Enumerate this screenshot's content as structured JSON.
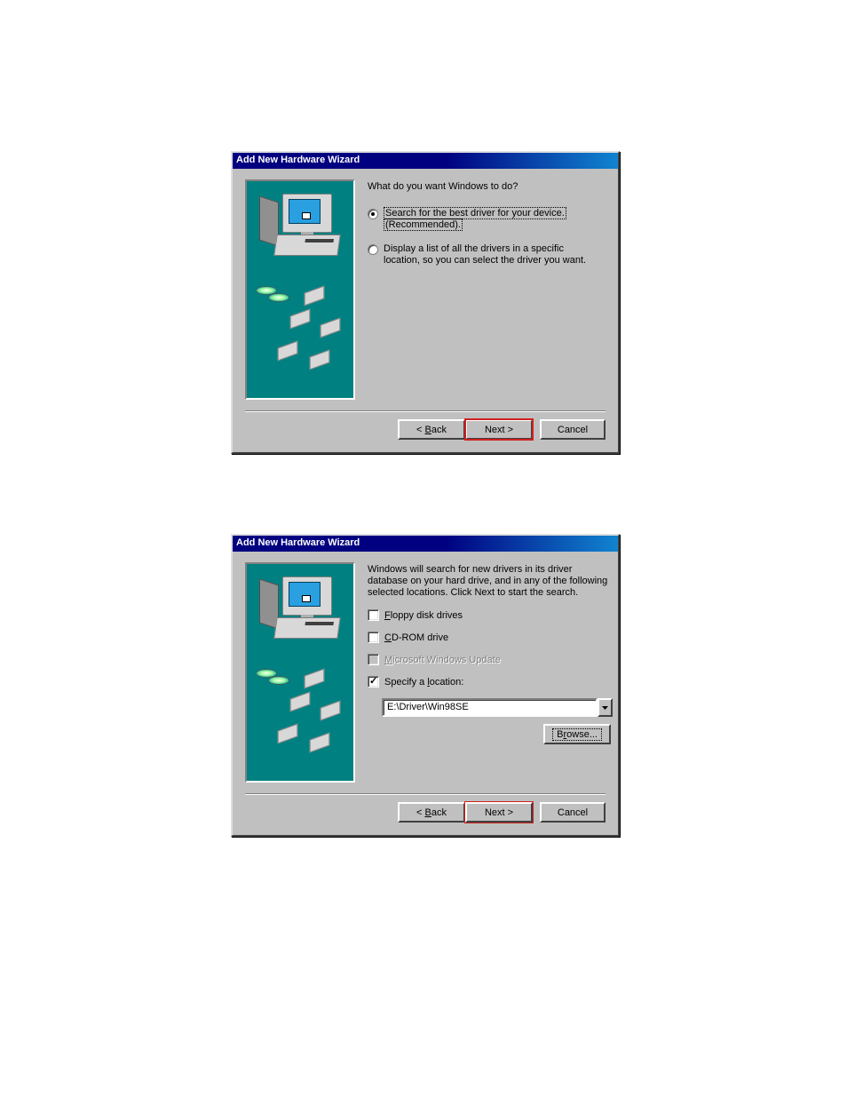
{
  "dialog1": {
    "title": "Add New Hardware Wizard",
    "prompt": "What do you want Windows to do?",
    "option1_line1": "Search for the best driver for your device.",
    "option1_line2": "(Recommended).",
    "option2_line1": "Display a list of all the drivers in a specific",
    "option2_line2": "location, so you can select the driver you want.",
    "back_label": "< ",
    "back_label2": "ack",
    "back_u": "B",
    "next_label": "Next >",
    "cancel_label": "Cancel"
  },
  "dialog2": {
    "title": "Add New Hardware Wizard",
    "intro": "Windows will search for new drivers in its driver database on your hard drive, and in any of the following selected locations. Click Next to start the search.",
    "check_floppy_u": "F",
    "check_floppy": "loppy disk drives",
    "check_cd_pre": "",
    "check_cd_u": "C",
    "check_cd": "D-ROM drive",
    "check_update_u": "M",
    "check_update": "icrosoft Windows Update",
    "check_loc_pre": "Specify a ",
    "check_loc_u": "l",
    "check_loc": "ocation:",
    "location_value": "E:\\Driver\\Win98SE",
    "browse_u": "r",
    "browse_pre": "B",
    "browse_post": "owse...",
    "back_pre": "< ",
    "back_u": "B",
    "back_post": "ack",
    "next_label": "Next >",
    "cancel_label": "Cancel"
  }
}
